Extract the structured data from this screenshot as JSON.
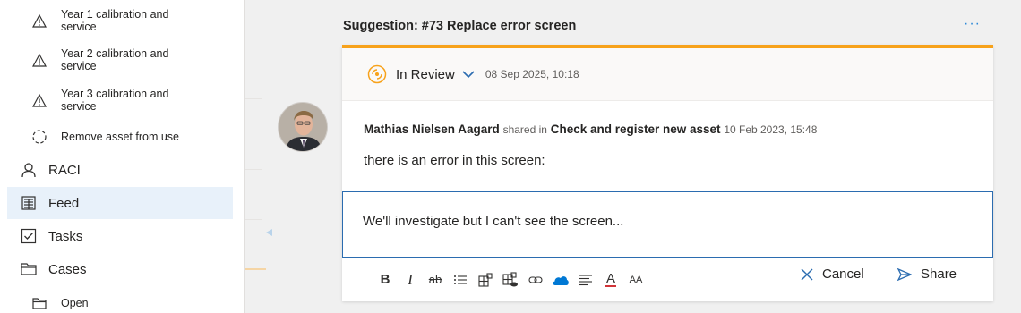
{
  "sidebar": {
    "sub_items": [
      {
        "icon": "warning-icon",
        "label_line1": "Year 1 calibration and",
        "label_line2": "service"
      },
      {
        "icon": "warning-icon",
        "label_line1": "Year 2 calibration and",
        "label_line2": "service"
      },
      {
        "icon": "warning-icon",
        "label_line1": "Year 3 calibration and",
        "label_line2": "service"
      },
      {
        "icon": "dashed-circle-icon",
        "label": "Remove asset from use"
      }
    ],
    "main_items": [
      {
        "icon": "person-icon",
        "label": "RACI"
      },
      {
        "icon": "feed-icon",
        "label": "Feed",
        "active": true
      },
      {
        "icon": "checkbox-icon",
        "label": "Tasks"
      },
      {
        "icon": "folder-icon",
        "label": "Cases"
      }
    ],
    "sub_cases": {
      "icon": "folder-icon",
      "label": "Open"
    }
  },
  "suggestion": {
    "title": "Suggestion: #73 Replace error screen",
    "more_label": "···",
    "accent_color": "#f7a21b"
  },
  "status": {
    "label": "In Review",
    "date": "08 Sep 2025, 10:18"
  },
  "post": {
    "author": "Mathias Nielsen Aagard",
    "shared_text": "shared in",
    "target": "Check and register new asset",
    "date": "10 Feb 2023, 15:48",
    "body": "there is an error in this screen:"
  },
  "reply": {
    "text": "We'll investigate but I can't see the screen..."
  },
  "toolbar": {
    "bold": "B",
    "italic": "I",
    "strike": "ab",
    "font_color": "A",
    "font_size": "AA",
    "cancel_label": "Cancel",
    "share_label": "Share"
  }
}
